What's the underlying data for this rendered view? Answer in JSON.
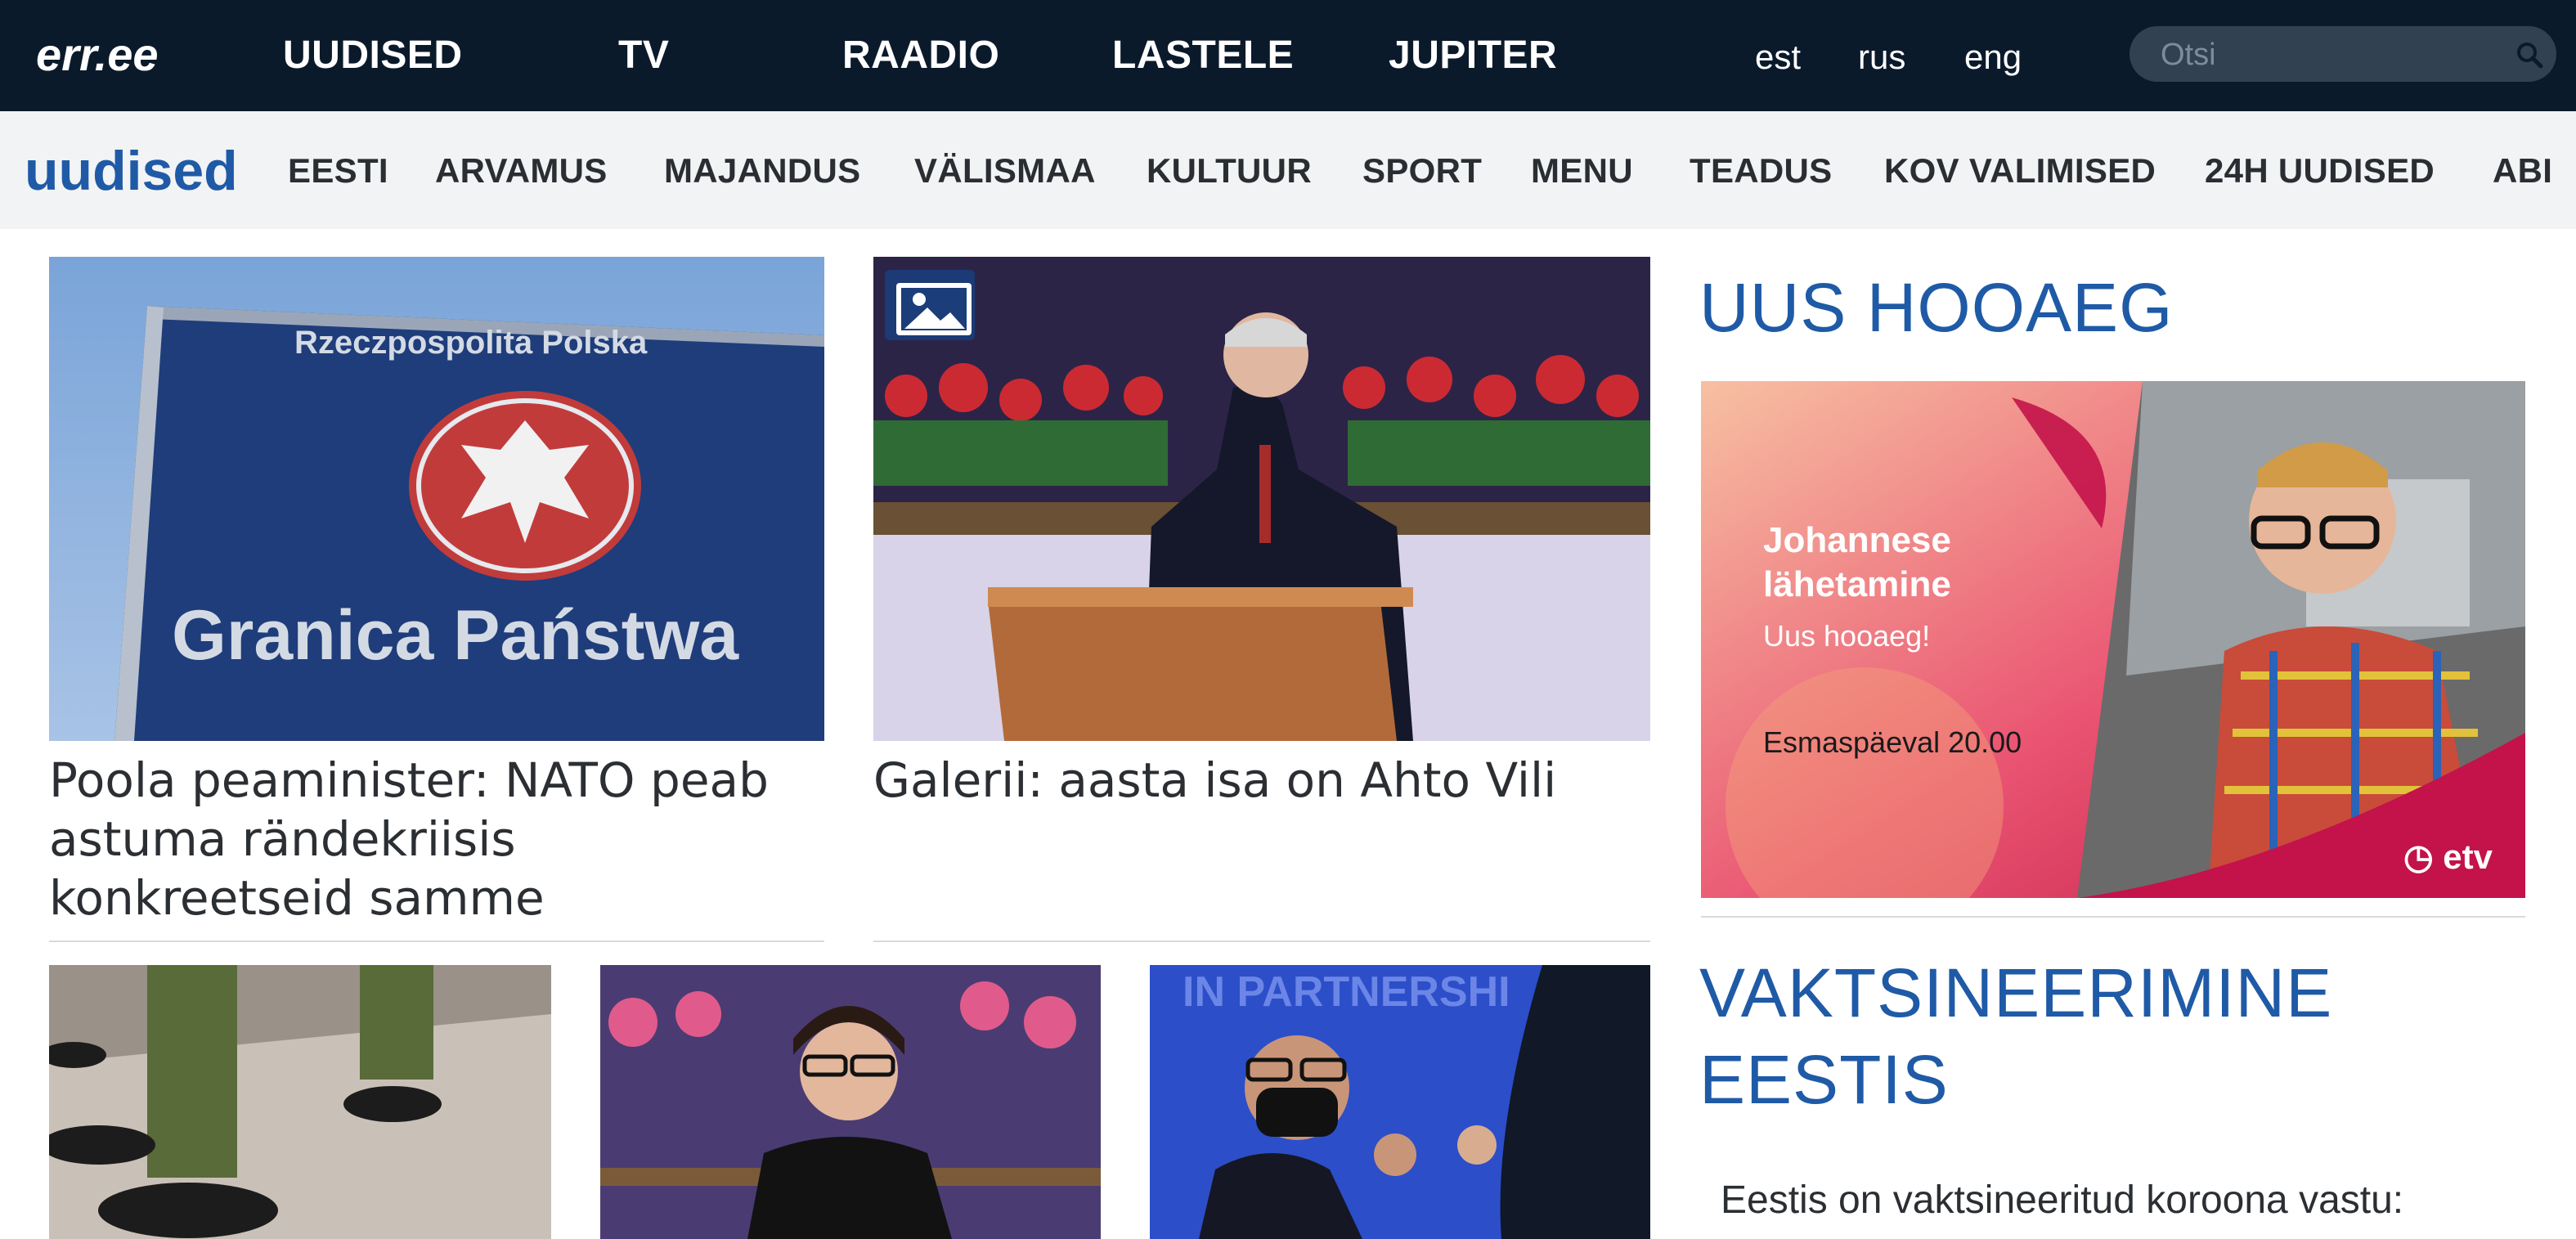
{
  "header": {
    "logo_text": "err.ee",
    "nav": [
      "UUDISED",
      "TV",
      "RAADIO",
      "LASTELE",
      "JUPITER"
    ],
    "languages": [
      "est",
      "rus",
      "eng"
    ],
    "search": {
      "placeholder": "Otsi",
      "icon": "search-icon"
    }
  },
  "section_nav": {
    "title": "uudised",
    "items": [
      "EESTI",
      "ARVAMUS",
      "MAJANDUS",
      "VÄLISMAA",
      "KULTUUR",
      "SPORT",
      "MENU",
      "TEADUS",
      "KOV VALIMISED",
      "24H UUDISED",
      "ABI"
    ]
  },
  "articles": [
    {
      "headline": "Poola peaminister: NATO peab astuma rändekriisis konkreetseid samme",
      "image_sign_top": "Rzeczpospolita Polska",
      "image_sign_bottom": "Granica Państwa"
    },
    {
      "headline": "Galerii: aasta isa on Ahto Vili",
      "gallery_icon": "gallery-icon"
    }
  ],
  "small_articles": [
    {
      "image": "soldiers-boots"
    },
    {
      "image": "woman-speaker"
    },
    {
      "image": "partnership-fist-bump",
      "image_text": "IN PARTNERSHI"
    }
  ],
  "aside": {
    "section1_title": "UUS HOOAEG",
    "promo": {
      "title": "Johannese lähetamine",
      "subtitle": "Uus hooaeg!",
      "time": "Esmaspäeval 20.00",
      "channel": "etv"
    },
    "section2_title_line1": "VAKTSINEERIMINE",
    "section2_title_line2": "EESTIS",
    "vaccination_text": "Eestis on vaktsineeritud koroona vastu:"
  },
  "colors": {
    "top_bar": "#0b1a2b",
    "accent_blue": "#1f5aa6",
    "section_bar": "#f2f3f4",
    "promo_pink": "#e04563"
  }
}
